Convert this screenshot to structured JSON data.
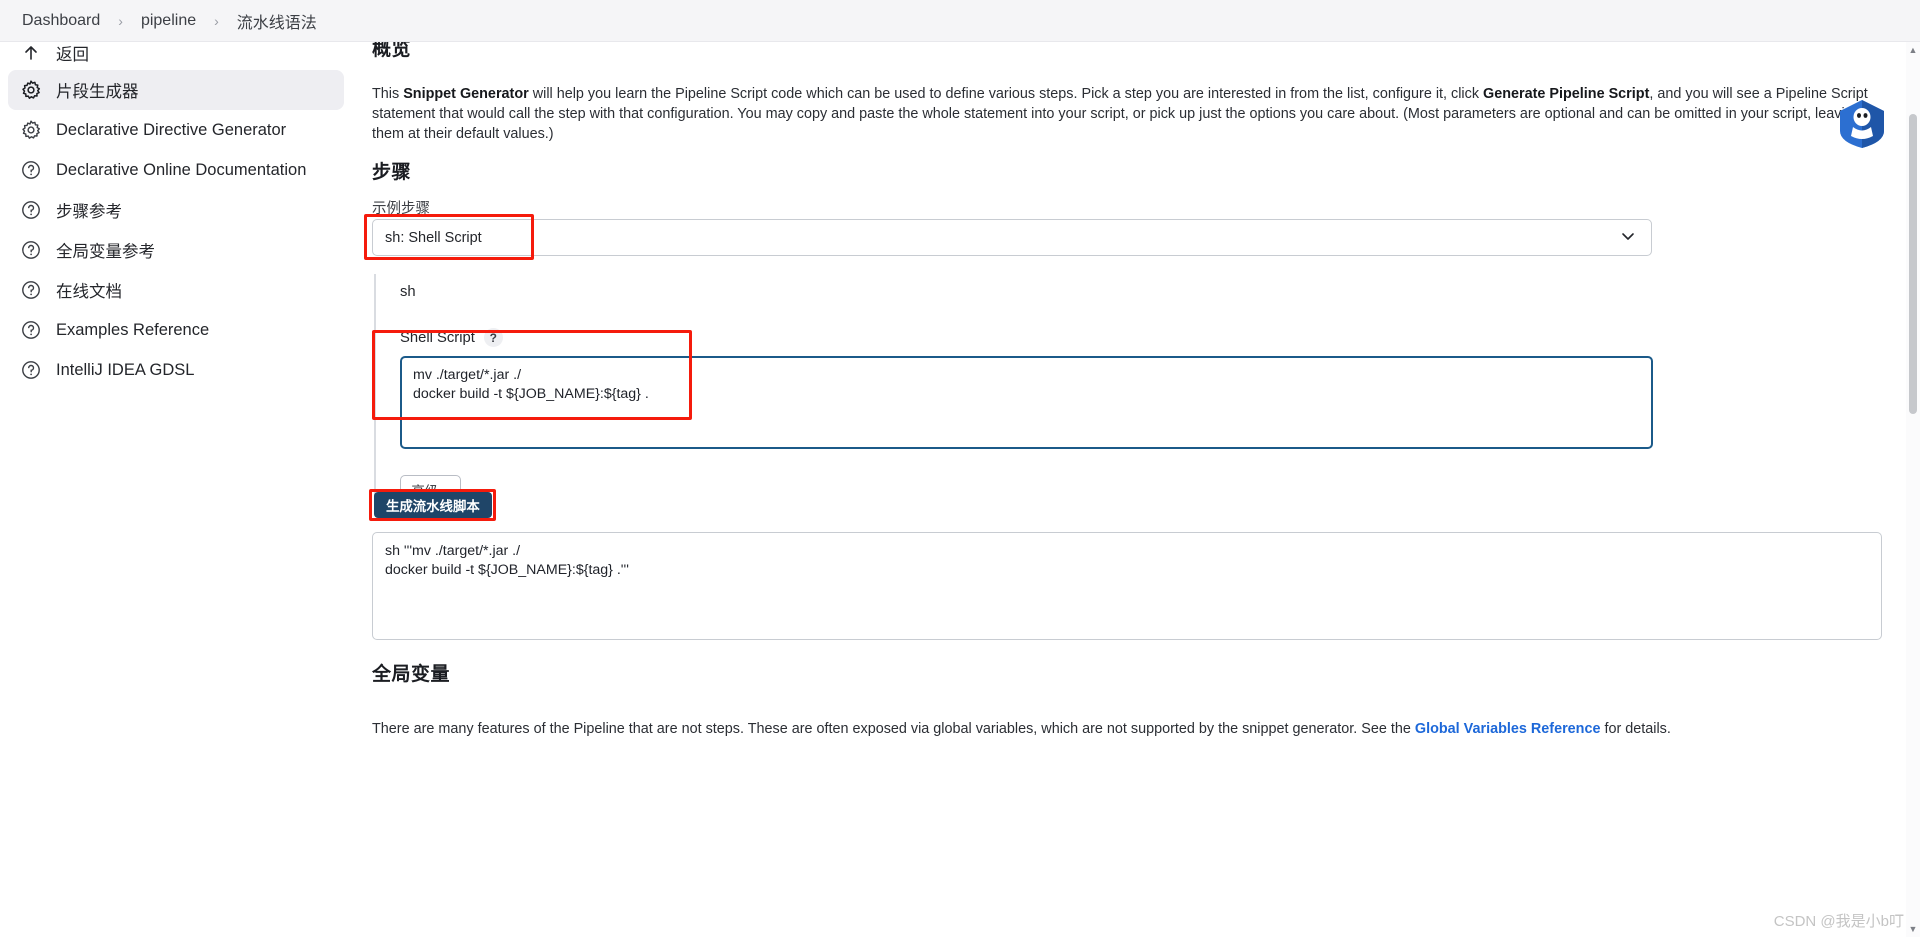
{
  "breadcrumb": {
    "items": [
      {
        "label": "Dashboard"
      },
      {
        "label": "pipeline"
      },
      {
        "label": "流水线语法"
      }
    ],
    "separator": "›"
  },
  "sidebar": {
    "items": [
      {
        "label": "返回",
        "icon": "up-arrow-icon"
      },
      {
        "label": "片段生成器",
        "icon": "gear-icon",
        "active": true
      },
      {
        "label": "Declarative Directive Generator",
        "icon": "gear-icon"
      },
      {
        "label": "Declarative Online Documentation",
        "icon": "question-icon"
      },
      {
        "label": "步骤参考",
        "icon": "question-icon"
      },
      {
        "label": "全局变量参考",
        "icon": "question-icon"
      },
      {
        "label": "在线文档",
        "icon": "question-icon"
      },
      {
        "label": "Examples Reference",
        "icon": "question-icon"
      },
      {
        "label": "IntelliJ IDEA GDSL",
        "icon": "question-icon"
      }
    ]
  },
  "overview": {
    "heading": "概览",
    "text_1": "This ",
    "bold_1": "Snippet Generator",
    "text_2": " will help you learn the Pipeline Script code which can be used to define various steps. Pick a step you are interested in from the list, configure it, click ",
    "bold_2": "Generate Pipeline Script",
    "text_3": ", and you will see a Pipeline Script statement that would call the step with that configuration. You may copy and paste the whole statement into your script, or pick up just the options you care about. (Most parameters are optional and can be omitted in your script, leaving them at their default values.)"
  },
  "steps": {
    "heading": "步骤",
    "sample_label": "示例步骤",
    "selected_step": "sh: Shell Script",
    "chevron_icon": "chevron-down-icon",
    "step_name": "sh",
    "field_label": "Shell Script",
    "help_icon": "?",
    "script_value": "mv ./target/*.jar ./\ndocker build -t ${JOB_NAME}:${tag} .",
    "advanced_label": "高级...",
    "generate_label": "生成流水线脚本",
    "generated_output": "sh '''mv ./target/*.jar ./\ndocker build -t ${JOB_NAME}:${tag} .'''"
  },
  "global_variables": {
    "heading": "全局变量",
    "text_1": "There are many features of the Pipeline that are not steps. These are often exposed via global variables, which are not supported by the snippet generator. See the ",
    "link": "Global Variables Reference",
    "text_2": " for details."
  },
  "watermark": {
    "text": "CSDN @我是小b叮"
  },
  "colors": {
    "annotation_red": "#f51b0c",
    "primary_button": "#1f4568",
    "link_blue": "#1d68d9",
    "focus_border": "#1b5a89",
    "sidebar_active": "#eeeef2"
  }
}
